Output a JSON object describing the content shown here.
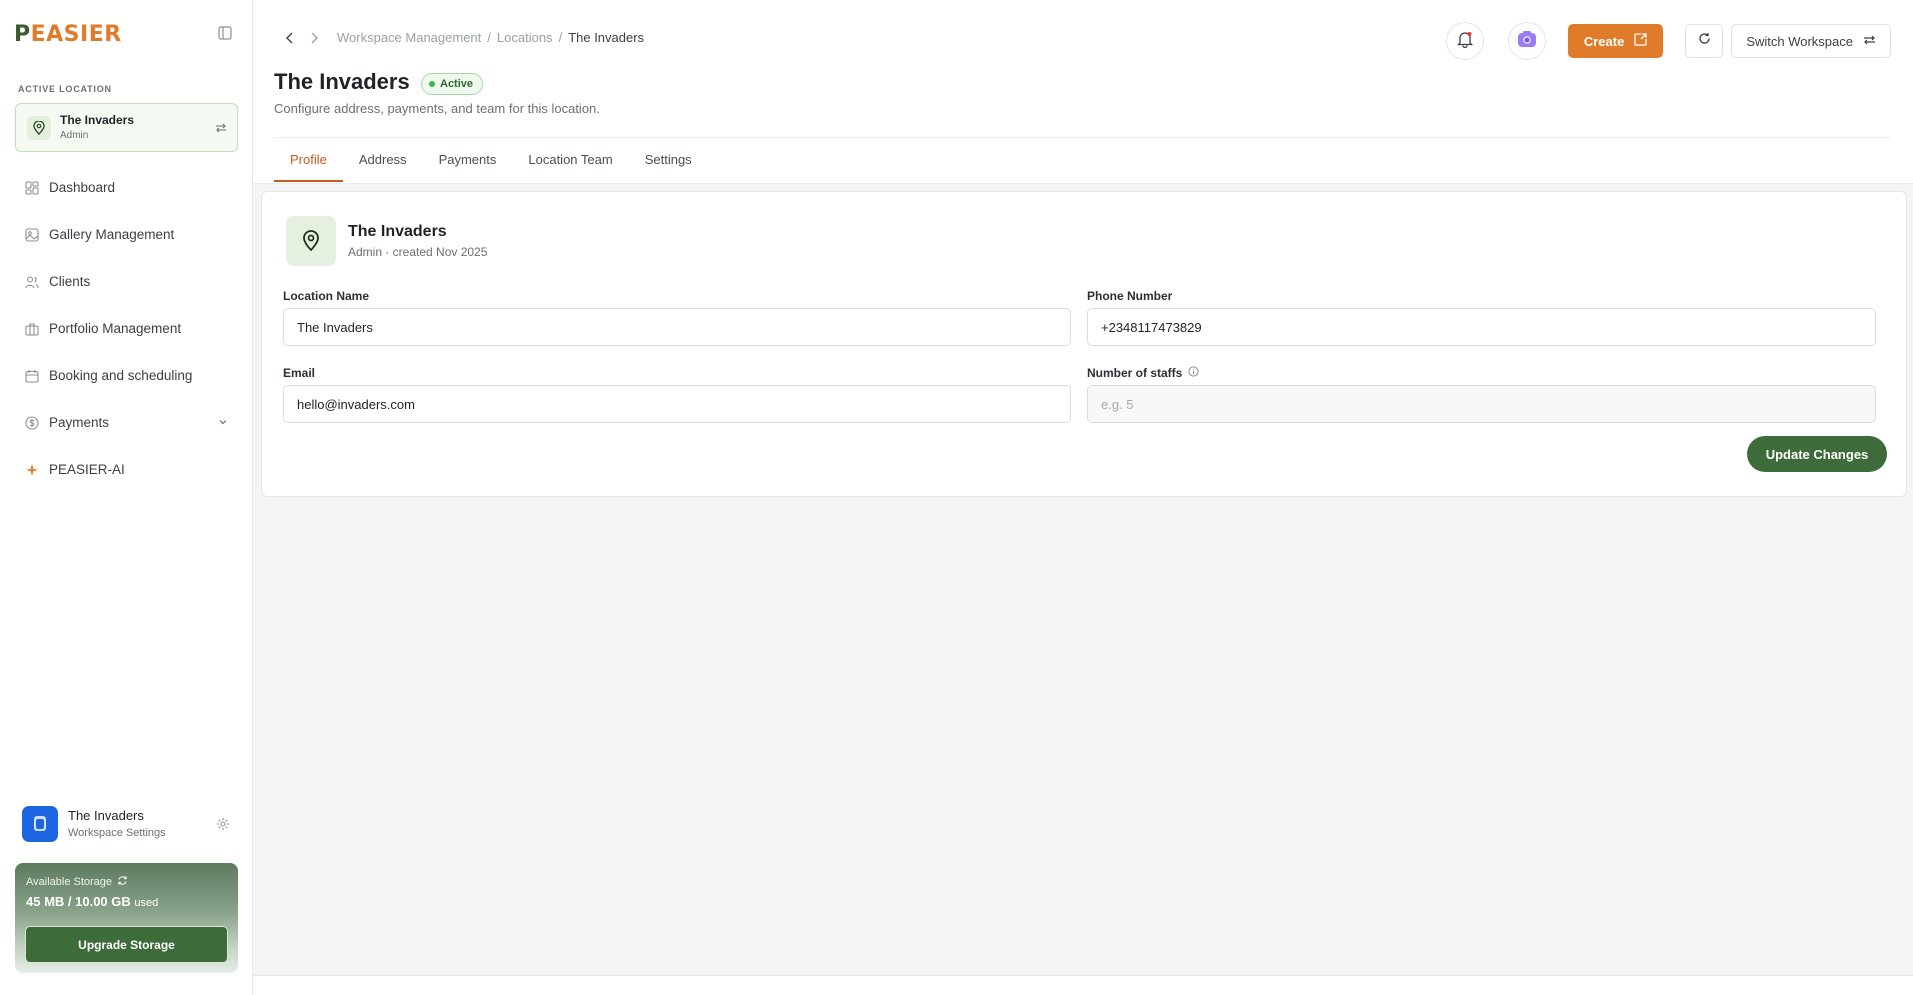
{
  "brand": {
    "logo_p": "P",
    "logo_rest": "EASIER"
  },
  "sidebar": {
    "active_location_label": "ACTIVE LOCATION",
    "active_location": {
      "name": "The Invaders",
      "role": "Admin"
    },
    "items": [
      {
        "label": "Dashboard",
        "icon": "dashboard-icon"
      },
      {
        "label": "Gallery Management",
        "icon": "gallery-icon"
      },
      {
        "label": "Clients",
        "icon": "users-icon"
      },
      {
        "label": "Portfolio Management",
        "icon": "portfolio-icon"
      },
      {
        "label": "Booking and scheduling",
        "icon": "calendar-icon"
      },
      {
        "label": "Payments",
        "icon": "dollar-icon"
      },
      {
        "label": "PEASIER-AI",
        "icon": "sparkle-icon"
      }
    ],
    "workspace": {
      "name": "The Invaders",
      "sub": "Workspace Settings"
    },
    "storage": {
      "label": "Available Storage",
      "value": "45 MB / 10.00 GB",
      "used": "used",
      "button": "Upgrade Storage"
    }
  },
  "header": {
    "breadcrumb": [
      "Workspace Management",
      "Locations",
      "The Invaders"
    ],
    "create_label": "Create",
    "switch_label": "Switch Workspace"
  },
  "page": {
    "title": "The Invaders",
    "status": "Active",
    "subtitle": "Configure address, payments, and team for this location.",
    "tabs": [
      "Profile",
      "Address",
      "Payments",
      "Location Team",
      "Settings"
    ]
  },
  "card": {
    "name": "The Invaders",
    "meta": "Admin · created Nov 2025",
    "fields": {
      "location_name": {
        "label": "Location Name",
        "value": "The Invaders"
      },
      "phone": {
        "label": "Phone Number",
        "value": "+2348117473829"
      },
      "email": {
        "label": "Email",
        "value": "hello@invaders.com"
      },
      "staffs": {
        "label": "Number of staffs",
        "placeholder": "e.g. 5"
      }
    },
    "update_label": "Update Changes"
  },
  "colors": {
    "accent": "#e07b2a",
    "brand_green": "#3d6b3a",
    "active_tab": "#c8591f"
  }
}
